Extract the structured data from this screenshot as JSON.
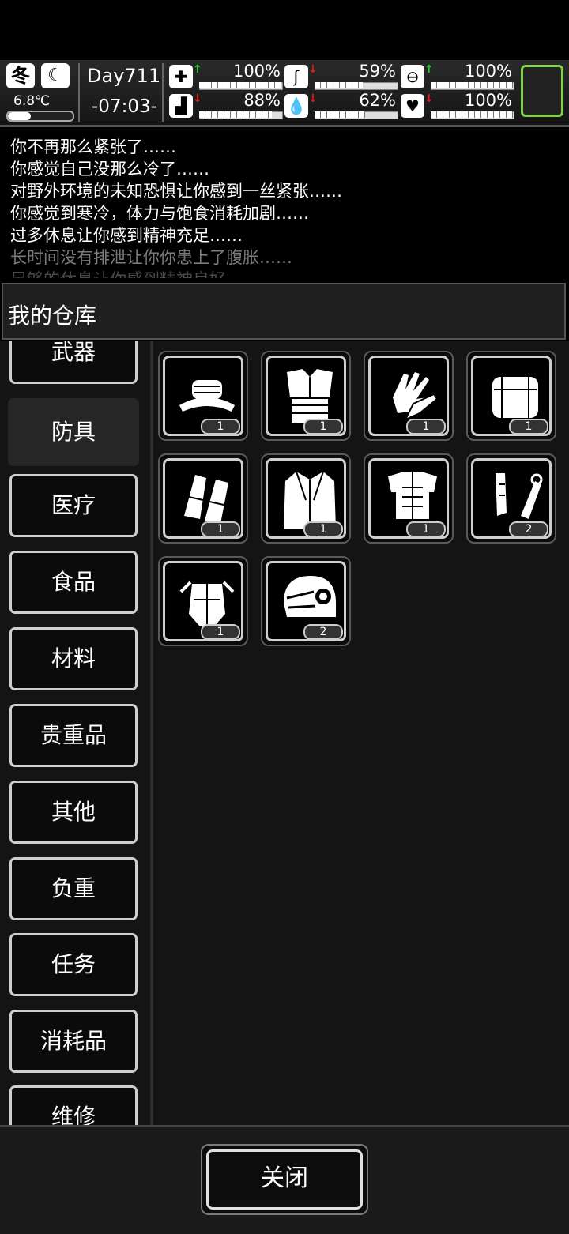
{
  "hud": {
    "season": "冬",
    "temperature": "6.8℃",
    "temperature_level": 0.35,
    "day": "Day711",
    "time": "-07:03-",
    "stats": [
      {
        "icon": "medkit-icon",
        "trend": "up",
        "percent": "100%",
        "value": 1.0
      },
      {
        "icon": "stomach-icon",
        "trend": "down",
        "percent": "59%",
        "value": 0.59
      },
      {
        "icon": "capsule-icon",
        "trend": "up",
        "percent": "100%",
        "value": 1.0
      },
      {
        "icon": "boot-icon",
        "trend": "down",
        "percent": "88%",
        "value": 0.88
      },
      {
        "icon": "water-drop-icon",
        "trend": "down",
        "percent": "62%",
        "value": 0.62
      },
      {
        "icon": "heart-icon",
        "trend": "down",
        "percent": "100%",
        "value": 1.0
      }
    ]
  },
  "log": [
    "你不再那么紧张了……",
    "你感觉自己没那么冷了……",
    "对野外环境的未知恐惧让你感到一丝紧张……",
    "你感觉到寒冷，体力与饱食消耗加剧……",
    "过多休息让你感到精神充足……",
    "长时间没有排泄让你你患上了腹胀……",
    "足够的休息让你感到精神良好"
  ],
  "panel": {
    "title": "我的仓库"
  },
  "categories": [
    "武器",
    "防具",
    "医疗",
    "食品",
    "材料",
    "贵重品",
    "其他",
    "负重",
    "任务",
    "消耗品",
    "维修"
  ],
  "active_category": "防具",
  "items": [
    {
      "icon": "fur-hat-icon",
      "qty": "1"
    },
    {
      "icon": "fur-vest-icon",
      "qty": "1"
    },
    {
      "icon": "gloves-icon",
      "qty": "1"
    },
    {
      "icon": "fur-pack-icon",
      "qty": "1"
    },
    {
      "icon": "fur-bracers-icon",
      "qty": "1"
    },
    {
      "icon": "fur-coat-icon",
      "qty": "1"
    },
    {
      "icon": "body-armor-icon",
      "qty": "1"
    },
    {
      "icon": "leg-guard-icon",
      "qty": "2"
    },
    {
      "icon": "mech-armor-icon",
      "qty": "1"
    },
    {
      "icon": "combat-helmet-icon",
      "qty": "2"
    }
  ],
  "close_label": "关闭"
}
